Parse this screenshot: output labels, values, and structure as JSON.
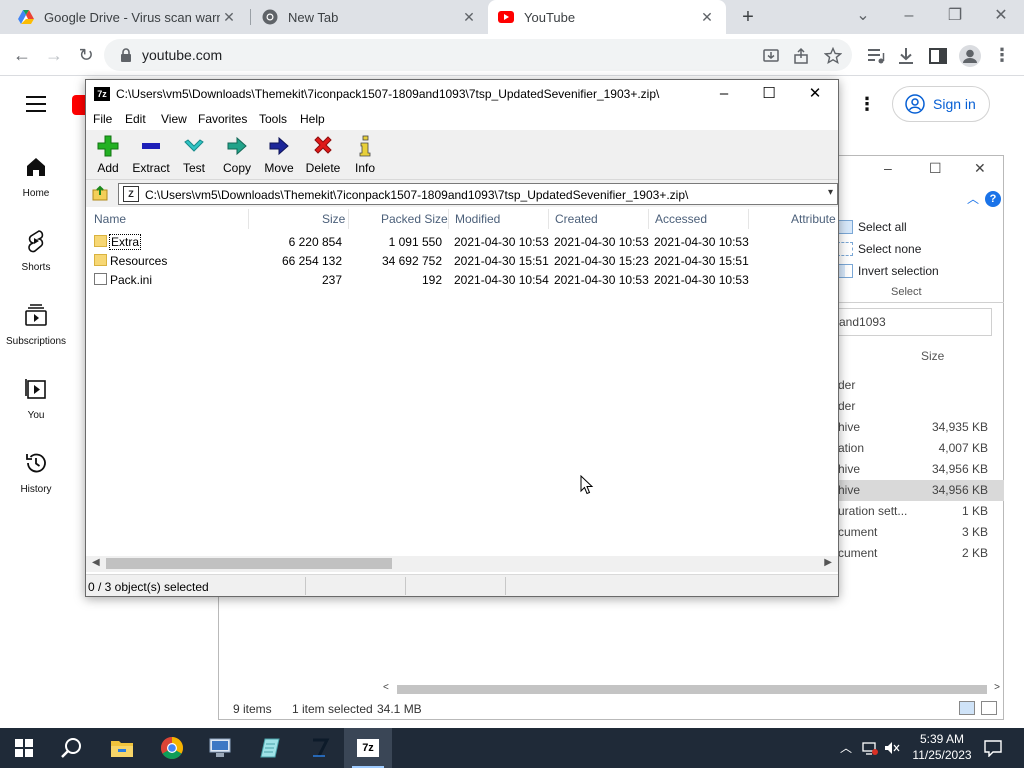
{
  "browser": {
    "tabs": [
      {
        "title": "Google Drive - Virus scan warning",
        "icon": "google-drive-icon",
        "active": false
      },
      {
        "title": "New Tab",
        "icon": "chrome-icon",
        "active": false
      },
      {
        "title": "YouTube",
        "icon": "youtube-icon",
        "active": true
      }
    ],
    "url": "youtube.com"
  },
  "youtube": {
    "nav": [
      {
        "label": "Home",
        "icon": "home-icon"
      },
      {
        "label": "Shorts",
        "icon": "shorts-icon"
      },
      {
        "label": "Subscriptions",
        "icon": "subscriptions-icon"
      },
      {
        "label": "You",
        "icon": "you-icon"
      },
      {
        "label": "History",
        "icon": "history-icon"
      }
    ],
    "signin_label": "Sign in"
  },
  "explorer": {
    "ribbon": {
      "select_all": "Select all",
      "select_none": "Select none",
      "invert_selection": "Invert selection",
      "group_label": "Select"
    },
    "search_fragment": "and1093",
    "size_header": "Size",
    "rows": [
      {
        "type": "der",
        "size": "",
        "selected": false
      },
      {
        "type": "der",
        "size": "",
        "selected": false
      },
      {
        "type": "hive",
        "size": "34,935 KB",
        "selected": false
      },
      {
        "type": "ation",
        "size": "4,007 KB",
        "selected": false
      },
      {
        "type": "hive",
        "size": "34,956 KB",
        "selected": false
      },
      {
        "type": "hive",
        "size": "34,956 KB",
        "selected": true
      },
      {
        "type": "uration sett...",
        "size": "1 KB",
        "selected": false
      },
      {
        "type": "cument",
        "size": "3 KB",
        "selected": false
      },
      {
        "type": "cument",
        "size": "2 KB",
        "selected": false
      }
    ],
    "status": {
      "items": "9 items",
      "selected": "1 item selected",
      "size": "34.1 MB"
    }
  },
  "zip": {
    "app_icon_text": "7z",
    "title": "C:\\Users\\vm5\\Downloads\\Themekit\\7iconpack1507-1809and1093\\7tsp_UpdatedSevenifier_1903+.zip\\",
    "menu": [
      "File",
      "Edit",
      "View",
      "Favorites",
      "Tools",
      "Help"
    ],
    "toolbar": [
      {
        "label": "Add",
        "icon": "add-icon"
      },
      {
        "label": "Extract",
        "icon": "extract-icon"
      },
      {
        "label": "Test",
        "icon": "test-icon"
      },
      {
        "label": "Copy",
        "icon": "copy-icon"
      },
      {
        "label": "Move",
        "icon": "move-icon"
      },
      {
        "label": "Delete",
        "icon": "delete-icon"
      },
      {
        "label": "Info",
        "icon": "info-icon"
      }
    ],
    "address": "C:\\Users\\vm5\\Downloads\\Themekit\\7iconpack1507-1809and1093\\7tsp_UpdatedSevenifier_1903+.zip\\",
    "columns": [
      "Name",
      "Size",
      "Packed Size",
      "Modified",
      "Created",
      "Accessed",
      "Attribute"
    ],
    "rows": [
      {
        "name": "Extra",
        "kind": "folder",
        "size": "6 220 854",
        "packed": "1 091 550",
        "modified": "2021-04-30 10:53",
        "created": "2021-04-30 10:53",
        "accessed": "2021-04-30 10:53"
      },
      {
        "name": "Resources",
        "kind": "folder",
        "size": "66 254 132",
        "packed": "34 692 752",
        "modified": "2021-04-30 15:51",
        "created": "2021-04-30 15:23",
        "accessed": "2021-04-30 15:51"
      },
      {
        "name": "Pack.ini",
        "kind": "file",
        "size": "237",
        "packed": "192",
        "modified": "2021-04-30 10:54",
        "created": "2021-04-30 10:53",
        "accessed": "2021-04-30 10:53"
      }
    ],
    "status": "0 / 3 object(s) selected"
  },
  "taskbar": {
    "apps": [
      "start-icon",
      "search-icon",
      "file-explorer-icon",
      "chrome-icon",
      "network-app-icon",
      "notepad-icon",
      "7zip-pinned-icon",
      "7zip-app-icon"
    ],
    "time": "5:39 AM",
    "date": "11/25/2023"
  }
}
